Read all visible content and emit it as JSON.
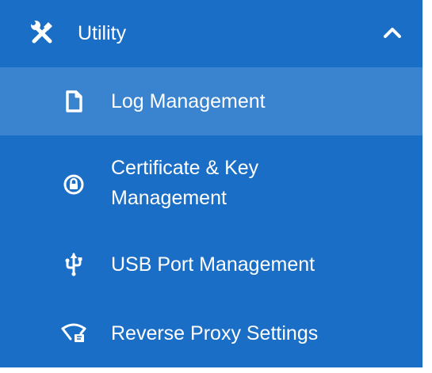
{
  "menu": {
    "header": {
      "label": "Utility",
      "icon": "tools-icon",
      "expanded": true
    },
    "items": [
      {
        "label": "Log Management",
        "icon": "document-icon",
        "active": true
      },
      {
        "label": "Certificate & Key Management",
        "icon": "lock-circle-icon",
        "active": false
      },
      {
        "label": "USB Port Management",
        "icon": "usb-icon",
        "active": false
      },
      {
        "label": "Reverse Proxy Settings",
        "icon": "reverse-proxy-icon",
        "active": false
      }
    ]
  },
  "colors": {
    "menu_background": "#1a6ec5",
    "active_background": "#3a83cf",
    "text": "#ffffff"
  }
}
